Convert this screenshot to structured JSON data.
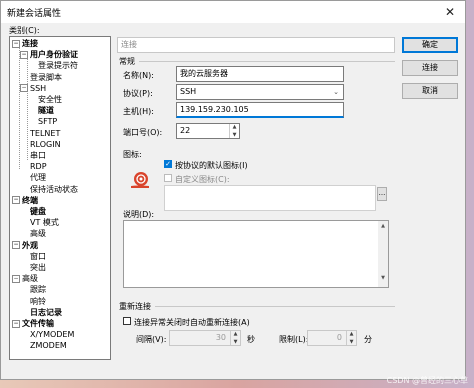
{
  "window": {
    "title": "新建会话属性",
    "close_glyph": "✕"
  },
  "category_label": "类别(C):",
  "tree": [
    {
      "label": "连接",
      "bold": true,
      "expander": "−",
      "level": 0
    },
    {
      "label": "用户身份验证",
      "bold": true,
      "expander": "−",
      "level": 1
    },
    {
      "label": "登录提示符",
      "bold": false,
      "level": 2
    },
    {
      "label": "登录脚本",
      "bold": false,
      "level": 1
    },
    {
      "label": "SSH",
      "bold": false,
      "expander": "−",
      "level": 1
    },
    {
      "label": "安全性",
      "bold": false,
      "level": 2
    },
    {
      "label": "隧道",
      "bold": true,
      "level": 2
    },
    {
      "label": "SFTP",
      "bold": false,
      "level": 2
    },
    {
      "label": "TELNET",
      "bold": false,
      "level": 1
    },
    {
      "label": "RLOGIN",
      "bold": false,
      "level": 1
    },
    {
      "label": "串口",
      "bold": false,
      "level": 1
    },
    {
      "label": "RDP",
      "bold": false,
      "level": 1
    },
    {
      "label": "代理",
      "bold": false,
      "level": 1
    },
    {
      "label": "保持活动状态",
      "bold": false,
      "level": 1
    },
    {
      "label": "终端",
      "bold": true,
      "expander": "−",
      "level": 0
    },
    {
      "label": "键盘",
      "bold": true,
      "level": 1
    },
    {
      "label": "VT 模式",
      "bold": false,
      "level": 1
    },
    {
      "label": "高级",
      "bold": false,
      "level": 1
    },
    {
      "label": "外观",
      "bold": true,
      "expander": "−",
      "level": 0
    },
    {
      "label": "窗口",
      "bold": false,
      "level": 1
    },
    {
      "label": "突出",
      "bold": false,
      "level": 1
    },
    {
      "label": "高级",
      "bold": false,
      "expander": "−",
      "level": 0
    },
    {
      "label": "跟踪",
      "bold": false,
      "level": 1
    },
    {
      "label": "响铃",
      "bold": false,
      "level": 1
    },
    {
      "label": "日志记录",
      "bold": true,
      "level": 1
    },
    {
      "label": "文件传输",
      "bold": true,
      "expander": "−",
      "level": 0
    },
    {
      "label": "X/YMODEM",
      "bold": false,
      "level": 1
    },
    {
      "label": "ZMODEM",
      "bold": false,
      "level": 1
    }
  ],
  "breadcrumb": "连接",
  "section_general": "常规",
  "fields": {
    "name_label": "名称(N):",
    "name_value": "我的云服务器",
    "protocol_label": "协议(P):",
    "protocol_value": "SSH",
    "host_label": "主机(H):",
    "host_value": "139.159.230.105",
    "port_label": "端口号(O):",
    "port_value": "22"
  },
  "icon_section": {
    "label": "图标:",
    "default_icon_label": "按协议的默认图标(I)",
    "default_checked": true,
    "custom_icon_label": "自定义图标(C):",
    "custom_checked": false,
    "browse_label": "..."
  },
  "description_label": "说明(D):",
  "reconnect": {
    "section_label": "重新连接",
    "auto_label": "连接异常关闭时自动重新连接(A)",
    "auto_checked": false,
    "interval_label": "间隔(V):",
    "interval_value": "30",
    "seconds_label": "秒",
    "limit_label": "限制(L):",
    "limit_value": "0",
    "minutes_label": "分"
  },
  "buttons": {
    "ok": "确定",
    "connect": "连接",
    "cancel": "取消"
  },
  "watermark": "CSDN @曾经的三心草",
  "colors": {
    "accent": "#0078d7",
    "window_bg": "#f0f0f0"
  }
}
